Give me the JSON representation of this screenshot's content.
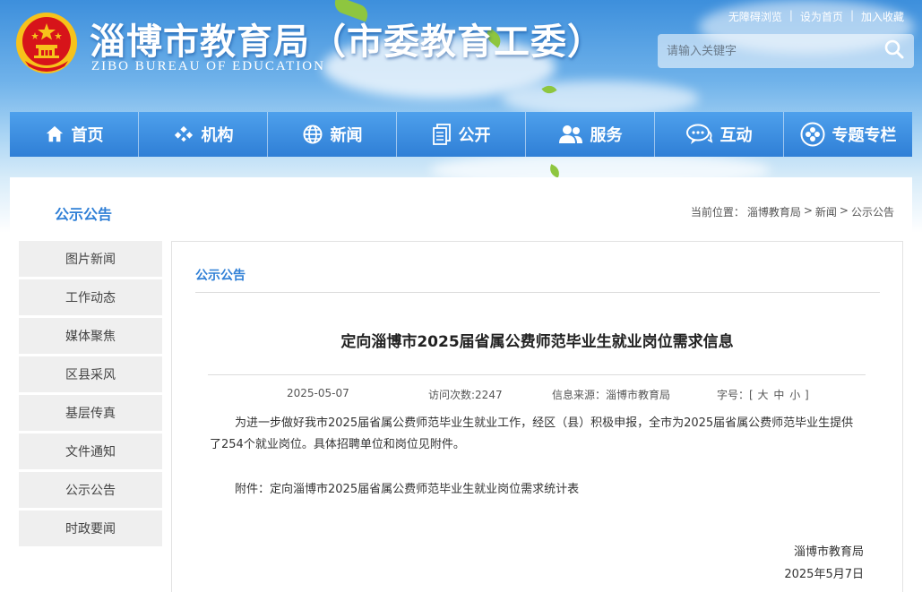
{
  "header": {
    "title": "淄博市教育局（市委教育工委）",
    "subtitle": "ZIBO BUREAU OF EDUCATION",
    "toplinks": [
      "无障碍浏览",
      "设为首页",
      "加入收藏"
    ],
    "search_placeholder": "请输入关键字"
  },
  "nav": {
    "items": [
      {
        "label": "首页",
        "icon": "home-icon"
      },
      {
        "label": "机构",
        "icon": "org-icon"
      },
      {
        "label": "新闻",
        "icon": "globe-icon"
      },
      {
        "label": "公开",
        "icon": "document-icon"
      },
      {
        "label": "服务",
        "icon": "users-icon"
      },
      {
        "label": "互动",
        "icon": "chat-icon"
      },
      {
        "label": "专题专栏",
        "icon": "special-icon"
      }
    ]
  },
  "page": {
    "section_title": "公示公告",
    "breadcrumb": {
      "prefix": "当前位置：",
      "items": [
        "淄博教育局",
        "新闻",
        "公示公告"
      ],
      "separator": ">"
    }
  },
  "sidebar": {
    "items": [
      "图片新闻",
      "工作动态",
      "媒体聚焦",
      "区县采风",
      "基层传真",
      "文件通知",
      "公示公告",
      "时政要闻"
    ]
  },
  "article": {
    "panel_title": "公示公告",
    "title": "定向淄博市2025届省属公费师范毕业生就业岗位需求信息",
    "date": "2025-05-07",
    "visits": "访问次数:2247",
    "source": "信息来源：淄博市教育局",
    "fontsize_label": "字号：[",
    "fontsize_large": "大",
    "fontsize_medium": "中",
    "fontsize_small": "小",
    "fontsize_end": "]",
    "body": "为进一步做好我市2025届省属公费师范毕业生就业工作，经区（县）积极申报，全市为2025届省属公费师范毕业生提供了254个就业岗位。具体招聘单位和岗位见附件。",
    "attachment_label": "附件：",
    "attachment_link": "定向淄博市2025届省属公费师范毕业生就业岗位需求统计表",
    "sign_org": "淄博市教育局",
    "sign_date": "2025年5月7日"
  },
  "colors": {
    "accent": "#2f7fd6",
    "nav_top": "#4ea0ec",
    "nav_bottom": "#2f7fd6",
    "sidebar_bg": "#efefef",
    "emblem_red": "#d7141a",
    "emblem_gold": "#f7c21b"
  }
}
